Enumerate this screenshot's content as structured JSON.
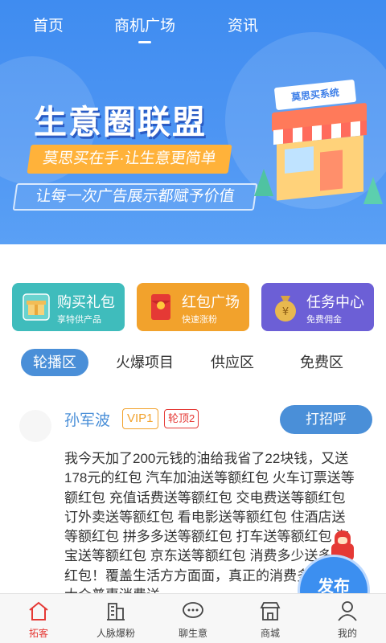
{
  "top_nav": {
    "tabs": [
      {
        "label": "首页",
        "active": false
      },
      {
        "label": "商机广场",
        "active": true
      },
      {
        "label": "资讯",
        "active": false
      }
    ]
  },
  "banner": {
    "title": "生意圈联盟",
    "subtitle": "莫思买在手·让生意更简单",
    "tagline": "让每一次广告展示都赋予价值",
    "shop_sign": "莫思买系统"
  },
  "feature_cards": [
    {
      "title": "购买礼包",
      "subtitle": "享特供产品",
      "icon": "gift-box-icon",
      "color": "#3fbcbc"
    },
    {
      "title": "红包广场",
      "subtitle": "快速涨粉",
      "icon": "red-envelope-icon",
      "color": "#f2a22c"
    },
    {
      "title": "任务中心",
      "subtitle": "免费佣金",
      "icon": "money-bag-icon",
      "color": "#6c5fd6"
    }
  ],
  "section_tabs": [
    {
      "label": "轮播区",
      "active": true
    },
    {
      "label": "火爆项目",
      "active": false
    },
    {
      "label": "供应区",
      "active": false
    },
    {
      "label": "免费区",
      "active": false
    }
  ],
  "post": {
    "author": "孙军波",
    "vip_badge": "VIP1",
    "top_badge": "轮顶2",
    "greet_button": "打招呼",
    "lines": [
      "我今天加了200元钱的油给我省了22块钱，又送",
      "178元的红包 汽车加油送等额红包 火车订票送等",
      "额红包 充值话费送等额红包 交电费送等额红包",
      "订外卖送等额红包 看电影送等额红包 住酒店送",
      "等额红包 拼多多送等额红包 打车送等额红包 淘",
      "宝送等额红包 京东送等额红包 消费多少送多少",
      "红包！覆盖生活方方面面，真正的消费多少送多少",
      "大众普惠消费送 …"
    ]
  },
  "publish_button": {
    "label": "发布"
  },
  "bottom_nav": [
    {
      "label": "拓客",
      "icon": "home-icon",
      "active": true
    },
    {
      "label": "人脉爆粉",
      "icon": "building-icon",
      "active": false
    },
    {
      "label": "聊生意",
      "icon": "chat-bubble-icon",
      "active": false
    },
    {
      "label": "商城",
      "icon": "store-icon",
      "active": false
    },
    {
      "label": "我的",
      "icon": "person-icon",
      "active": false
    }
  ],
  "colors": {
    "primary_blue": "#4a8fd8",
    "banner_blue": "#4d95f3",
    "active_red": "#e53935"
  }
}
